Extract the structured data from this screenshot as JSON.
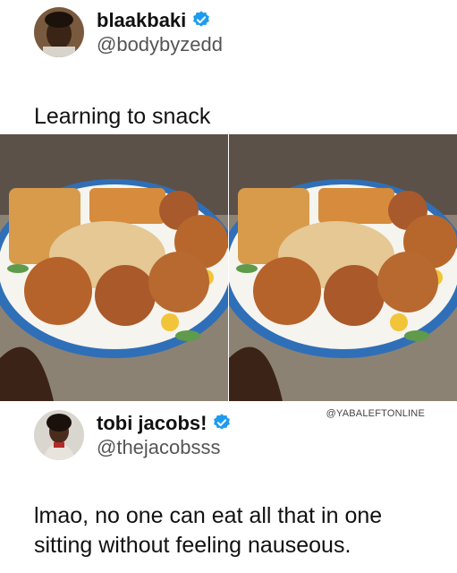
{
  "tweet1": {
    "display_name": "blaakbaki",
    "handle": "@bodybyzedd",
    "text": "Learning to snack"
  },
  "watermark": "@YABALEFTONLINE",
  "tweet2": {
    "display_name": "tobi jacobs!",
    "handle": "@thejacobsss",
    "text_line1": "lmao, no one can eat all that in one",
    "text_line2": "sitting without feeling nauseous."
  },
  "colors": {
    "verified": "#1d9bf0",
    "text": "#111111",
    "handle": "#555555"
  },
  "icons": [
    "verified-badge-icon"
  ]
}
